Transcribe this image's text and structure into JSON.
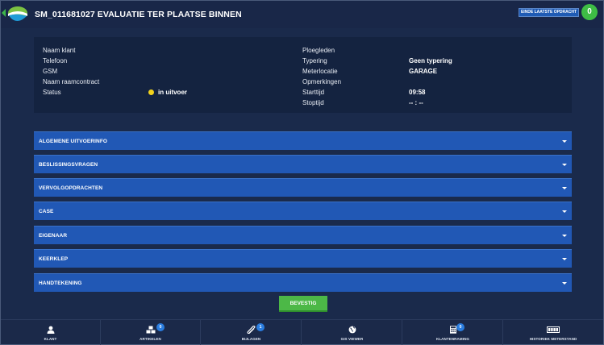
{
  "header": {
    "title": "SM_011681027 EVALUATIE TER PLAATSE BINNEN",
    "end_button_label": "EINDE LAATSTE OPDRACHT",
    "counter": "0"
  },
  "info": {
    "left": [
      {
        "label": "Naam klant",
        "value": ""
      },
      {
        "label": "Telefoon",
        "value": ""
      },
      {
        "label": "GSM",
        "value": ""
      },
      {
        "label": "Naam raamcontract",
        "value": ""
      },
      {
        "label": "Status",
        "value": "in uitvoer"
      }
    ],
    "right": [
      {
        "label": "Ploegleden",
        "value": ""
      },
      {
        "label": "Typering",
        "value": "Geen typering"
      },
      {
        "label": "Meterlocatie",
        "value": "GARAGE"
      },
      {
        "label": "Opmerkingen",
        "value": ""
      },
      {
        "label": "Starttijd",
        "value": "09:58"
      },
      {
        "label": "Stoptijd",
        "value": "-- : --"
      }
    ],
    "status_color": "#f2d21c"
  },
  "sections": [
    {
      "label": "ALGEMENE UITVOERINFO"
    },
    {
      "label": "BESLISSINGSVRAGEN"
    },
    {
      "label": "VERVOLGOPDRACHTEN"
    },
    {
      "label": "CASE"
    },
    {
      "label": "EIGENAAR"
    },
    {
      "label": "KEERKLEP"
    },
    {
      "label": "HANDTEKENING"
    }
  ],
  "confirm_label": "BEVESTIG",
  "bottom_nav": [
    {
      "label": "KLANT",
      "icon": "person-icon",
      "badge": ""
    },
    {
      "label": "ARTIKELEN",
      "icon": "boxes-icon",
      "badge": "0"
    },
    {
      "label": "BIJLAGEN",
      "icon": "paperclip-icon",
      "badge": "1"
    },
    {
      "label": "GIS VIEWER",
      "icon": "globe-icon",
      "badge": ""
    },
    {
      "label": "KLANTENRAMING",
      "icon": "calculator-icon",
      "badge": "0"
    },
    {
      "label": "HISTORIEK METERSTAND",
      "icon": "meter-icon",
      "badge": ""
    }
  ],
  "colors": {
    "background": "#1a2a4b",
    "accordion": "#2158b5",
    "confirm": "#4cb847",
    "counter": "#3ebd45",
    "badge": "#2a7de0"
  }
}
